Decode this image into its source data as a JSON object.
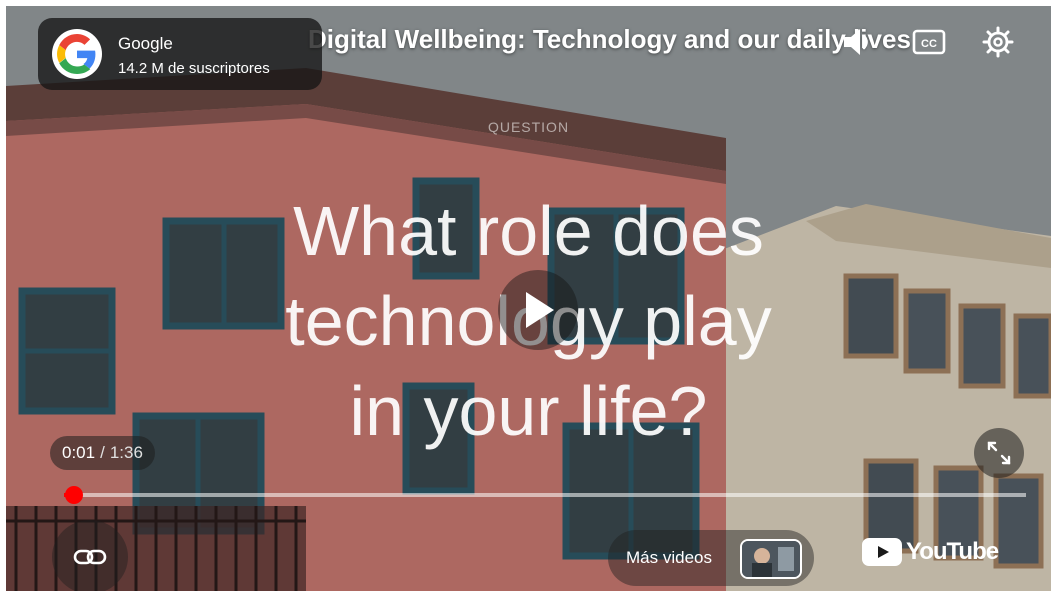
{
  "channel": {
    "name": "Google",
    "subscribers": "14.2 M de suscriptores",
    "logo_icon": "google-g-icon"
  },
  "video": {
    "title": "Digital Wellbeing: Technology and our daily lives"
  },
  "controls": {
    "volume_icon": "volume-icon",
    "captions_icon": "closed-captions-icon",
    "settings_icon": "gear-icon",
    "play_icon": "play-icon",
    "fullscreen_icon": "fullscreen-icon",
    "link_icon": "link-icon",
    "current_time": "0:01",
    "separator": "/",
    "duration": "1:36",
    "progress_fraction": 0.01,
    "more_videos_label": "Más videos",
    "youtube_logo_text": "YouTube"
  },
  "slide": {
    "label": "QUESTION",
    "lines": [
      "What role does",
      "technology play",
      "in your life?"
    ]
  },
  "colors": {
    "progress": "#ff0000",
    "youtube_red": "#ff0000",
    "building_pink": "#d9847c",
    "building_cream": "#e9e0cd",
    "window_frame": "#2f5b6b"
  }
}
